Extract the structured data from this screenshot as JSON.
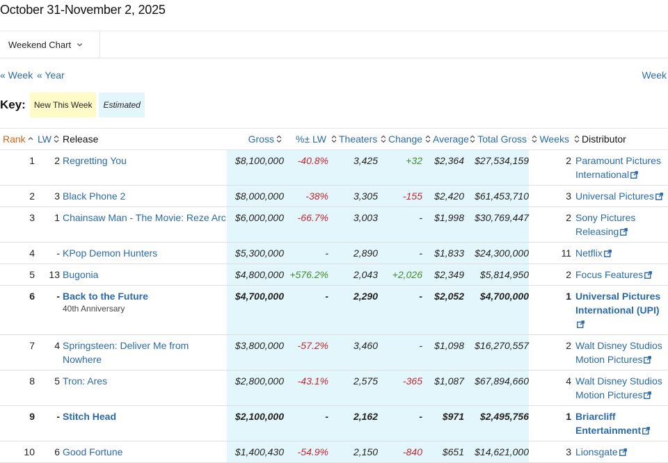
{
  "page": {
    "title": "October 31-November 2, 2025",
    "chart_select": "Weekend Chart",
    "nav": {
      "prev_week": "« Week",
      "prev_year": "« Year",
      "next_week": "Week"
    },
    "key": {
      "label": "Key:",
      "new_this_week": "New This Week",
      "estimated": "Estimated"
    }
  },
  "table": {
    "headers": {
      "rank": "Rank",
      "lw": "LW",
      "release": "Release",
      "gross": "Gross",
      "pct_lw": "%± LW",
      "theaters": "Theaters",
      "change": "Change",
      "average": "Average",
      "total_gross": "Total Gross",
      "weeks": "Weeks",
      "distributor": "Distributor"
    },
    "rows": [
      {
        "rank": "1",
        "lw": "2",
        "release": "Regretting You",
        "sub": "",
        "gross": "$8,100,000",
        "pct_lw": "-40.8%",
        "theaters": "3,425",
        "change": "+32",
        "average": "$2,364",
        "total_gross": "$27,534,159",
        "weeks": "2",
        "distributor": "Paramount Pictures International"
      },
      {
        "rank": "2",
        "lw": "3",
        "release": "Black Phone 2",
        "sub": "",
        "gross": "$8,000,000",
        "pct_lw": "-38%",
        "theaters": "3,305",
        "change": "-155",
        "average": "$2,420",
        "total_gross": "$61,453,710",
        "weeks": "3",
        "distributor": "Universal Pictures"
      },
      {
        "rank": "3",
        "lw": "1",
        "release": "Chainsaw Man - The Movie: Reze Arc",
        "sub": "",
        "gross": "$6,000,000",
        "pct_lw": "-66.7%",
        "theaters": "3,003",
        "change": "-",
        "average": "$1,998",
        "total_gross": "$30,769,447",
        "weeks": "2",
        "distributor": "Sony Pictures Releasing"
      },
      {
        "rank": "4",
        "lw": "-",
        "release": "KPop Demon Hunters",
        "sub": "",
        "gross": "$5,300,000",
        "pct_lw": "-",
        "theaters": "2,890",
        "change": "-",
        "average": "$1,833",
        "total_gross": "$24,300,000",
        "weeks": "11",
        "distributor": "Netflix"
      },
      {
        "rank": "5",
        "lw": "13",
        "release": "Bugonia",
        "sub": "",
        "gross": "$4,800,000",
        "pct_lw": "+576.2%",
        "theaters": "2,043",
        "change": "+2,026",
        "average": "$2,349",
        "total_gross": "$5,814,950",
        "weeks": "2",
        "distributor": "Focus Features"
      },
      {
        "rank": "6",
        "lw": "-",
        "release": "Back to the Future",
        "sub": "40th Anniversary",
        "gross": "$4,700,000",
        "pct_lw": "-",
        "theaters": "2,290",
        "change": "-",
        "average": "$2,052",
        "total_gross": "$4,700,000",
        "weeks": "1",
        "distributor": "Universal Pictures International (UPI)"
      },
      {
        "rank": "7",
        "lw": "4",
        "release": "Springsteen: Deliver Me from Nowhere",
        "sub": "",
        "gross": "$3,800,000",
        "pct_lw": "-57.2%",
        "theaters": "3,460",
        "change": "-",
        "average": "$1,098",
        "total_gross": "$16,270,557",
        "weeks": "2",
        "distributor": "Walt Disney Studios Motion Pictures"
      },
      {
        "rank": "8",
        "lw": "5",
        "release": "Tron: Ares",
        "sub": "",
        "gross": "$2,800,000",
        "pct_lw": "-43.1%",
        "theaters": "2,575",
        "change": "-365",
        "average": "$1,087",
        "total_gross": "$67,894,660",
        "weeks": "4",
        "distributor": "Walt Disney Studios Motion Pictures"
      },
      {
        "rank": "9",
        "lw": "-",
        "release": "Stitch Head",
        "sub": "",
        "gross": "$2,100,000",
        "pct_lw": "-",
        "theaters": "2,162",
        "change": "-",
        "average": "$971",
        "total_gross": "$2,495,756",
        "weeks": "1",
        "distributor": "Briarcliff Entertainment"
      },
      {
        "rank": "10",
        "lw": "6",
        "release": "Good Fortune",
        "sub": "",
        "gross": "$1,400,430",
        "pct_lw": "-54.9%",
        "theaters": "2,150",
        "change": "-840",
        "average": "$651",
        "total_gross": "$14,621,000",
        "weeks": "3",
        "distributor": "Lionsgate"
      }
    ]
  },
  "colors": {
    "link": "#2a6aa8",
    "positive": "#3f8c2a",
    "negative": "#c1262e",
    "sorted_header": "#d2661b",
    "estimated_bg": "#e3f6fc",
    "new_bg": "#fffbc9"
  }
}
